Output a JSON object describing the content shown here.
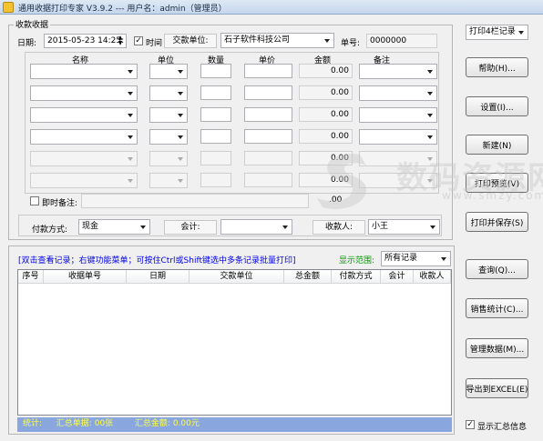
{
  "window": {
    "title": "通用收据打印专家 V3.9.2 --- 用户名：admin（管理员）"
  },
  "receipt": {
    "section_title": "收款收据",
    "date_label": "日期:",
    "date_value": "2015-05-23 14:25:",
    "time_checkbox_label": "时间",
    "time_checked": true,
    "payer_label": "交款单位:",
    "payer_value": "石子软件科技公司",
    "number_label": "单号:",
    "number_value": "0000000",
    "columns": [
      "名称",
      "单位",
      "数量",
      "单价",
      "金额",
      "备注"
    ],
    "line_amounts": [
      "0.00",
      "0.00",
      "0.00",
      "0.00",
      "0.00",
      "0.00"
    ],
    "instant_note_label": "即时备注:",
    "instant_note_checked": false,
    "total_amount_fragment": ".00",
    "payment_method_label": "付款方式:",
    "payment_method_value": "现金",
    "accountant_label": "会计:",
    "accountant_value": "",
    "payee_label": "收款人:",
    "payee_value": "小王"
  },
  "right_panel": {
    "print_mode": "打印4栏记录",
    "buttons": [
      "帮助(H)...",
      "设置(I)...",
      "新建(N)",
      "打印预览(V)",
      "打印并保存(S)",
      "查询(Q)...",
      "销售统计(C)...",
      "管理数据(M)...",
      "导出到EXCEL(E)"
    ],
    "show_summary_label": "显示汇总信息",
    "show_summary_checked": true
  },
  "records": {
    "hint": "[双击查看记录；右键功能菜单；可按住Ctrl或Shift键选中多条记录批量打印]",
    "range_label": "显示范围:",
    "range_value": "所有记录",
    "columns": [
      "序号",
      "收据单号",
      "日期",
      "交款单位",
      "总金额",
      "付款方式",
      "会计",
      "收款人"
    ],
    "rows": []
  },
  "status": {
    "stats_label": "统计:",
    "total_receipts_label": "汇总单据:",
    "total_receipts_value": "00张",
    "total_amount_label": "汇总金额:",
    "total_amount_value": "0.00元"
  },
  "watermark": {
    "text": "数码资源网",
    "sub": "www.smzy.com"
  },
  "colors": {
    "status_bar_bg": "#89a6df",
    "status_text": "#ffff40",
    "hint_text": "#0000ee",
    "range_label": "#009a00"
  }
}
